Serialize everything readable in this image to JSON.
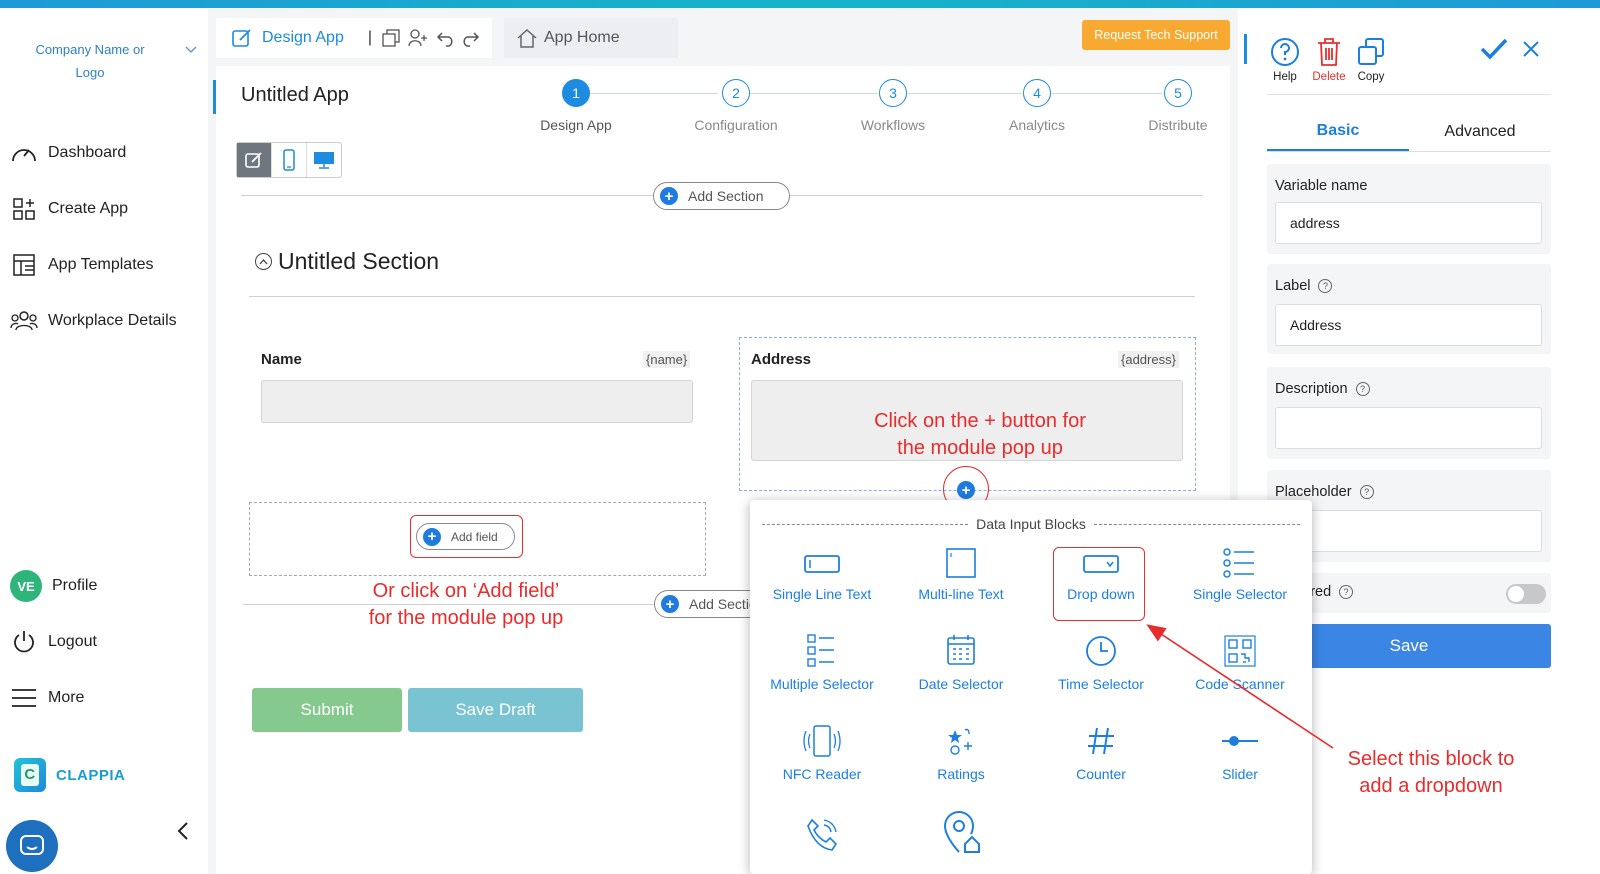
{
  "sidebar": {
    "company": "Company Name or Logo",
    "items": [
      {
        "label": "Dashboard",
        "icon": "gauge-icon"
      },
      {
        "label": "Create App",
        "icon": "grid-plus-icon"
      },
      {
        "label": "App Templates",
        "icon": "template-icon"
      },
      {
        "label": "Workplace Details",
        "icon": "people-icon"
      }
    ],
    "profile": {
      "initials": "VE",
      "label": "Profile"
    },
    "logout": "Logout",
    "more": "More",
    "brand": "CLAPPIA"
  },
  "header": {
    "design_tab": "Design App",
    "home_tab": "App Home",
    "support": "Request Tech Support"
  },
  "app": {
    "title": "Untitled App",
    "steps": [
      {
        "num": "1",
        "label": "Design App"
      },
      {
        "num": "2",
        "label": "Configuration"
      },
      {
        "num": "3",
        "label": "Workflows"
      },
      {
        "num": "4",
        "label": "Analytics"
      },
      {
        "num": "5",
        "label": "Distribute"
      }
    ],
    "add_section": "Add Section",
    "add_section_2": "Add Sectio",
    "section_title": "Untitled Section",
    "fields": [
      {
        "label": "Name",
        "var": "{name}"
      },
      {
        "label": "Address",
        "var": "{address}"
      }
    ],
    "add_field": "Add field",
    "submit": "Submit",
    "save_draft": "Save Draft"
  },
  "annotations": {
    "plus_note_1": "Click on the + button for",
    "plus_note_2": "the module pop up",
    "add_field_note_1": "Or click on ‘Add field’",
    "add_field_note_2": "for the module pop up",
    "select_note_1": "Select this block to",
    "select_note_2": "add a dropdown"
  },
  "popup": {
    "title": "Data Input Blocks",
    "blocks": [
      "Single Line Text",
      "Multi-line Text",
      "Drop down",
      "Single Selector",
      "Multiple Selector",
      "Date Selector",
      "Time Selector",
      "Code Scanner",
      "NFC Reader",
      "Ratings",
      "Counter",
      "Slider"
    ]
  },
  "panel": {
    "help": "Help",
    "delete": "Delete",
    "copy": "Copy",
    "tab_basic": "Basic",
    "tab_advanced": "Advanced",
    "variable_label": "Variable name",
    "variable_value": "address",
    "label_label": "Label",
    "label_value": "Address",
    "description_label": "Description",
    "description_value": "",
    "placeholder_label": "Placeholder",
    "placeholder_value": "",
    "required_label": "ired",
    "save": "Save"
  },
  "colors": {
    "accent": "#1c8be0",
    "annotation": "#e82c2c",
    "support": "#f7a931",
    "submit": "#86c98f",
    "draft": "#79c3d2"
  }
}
